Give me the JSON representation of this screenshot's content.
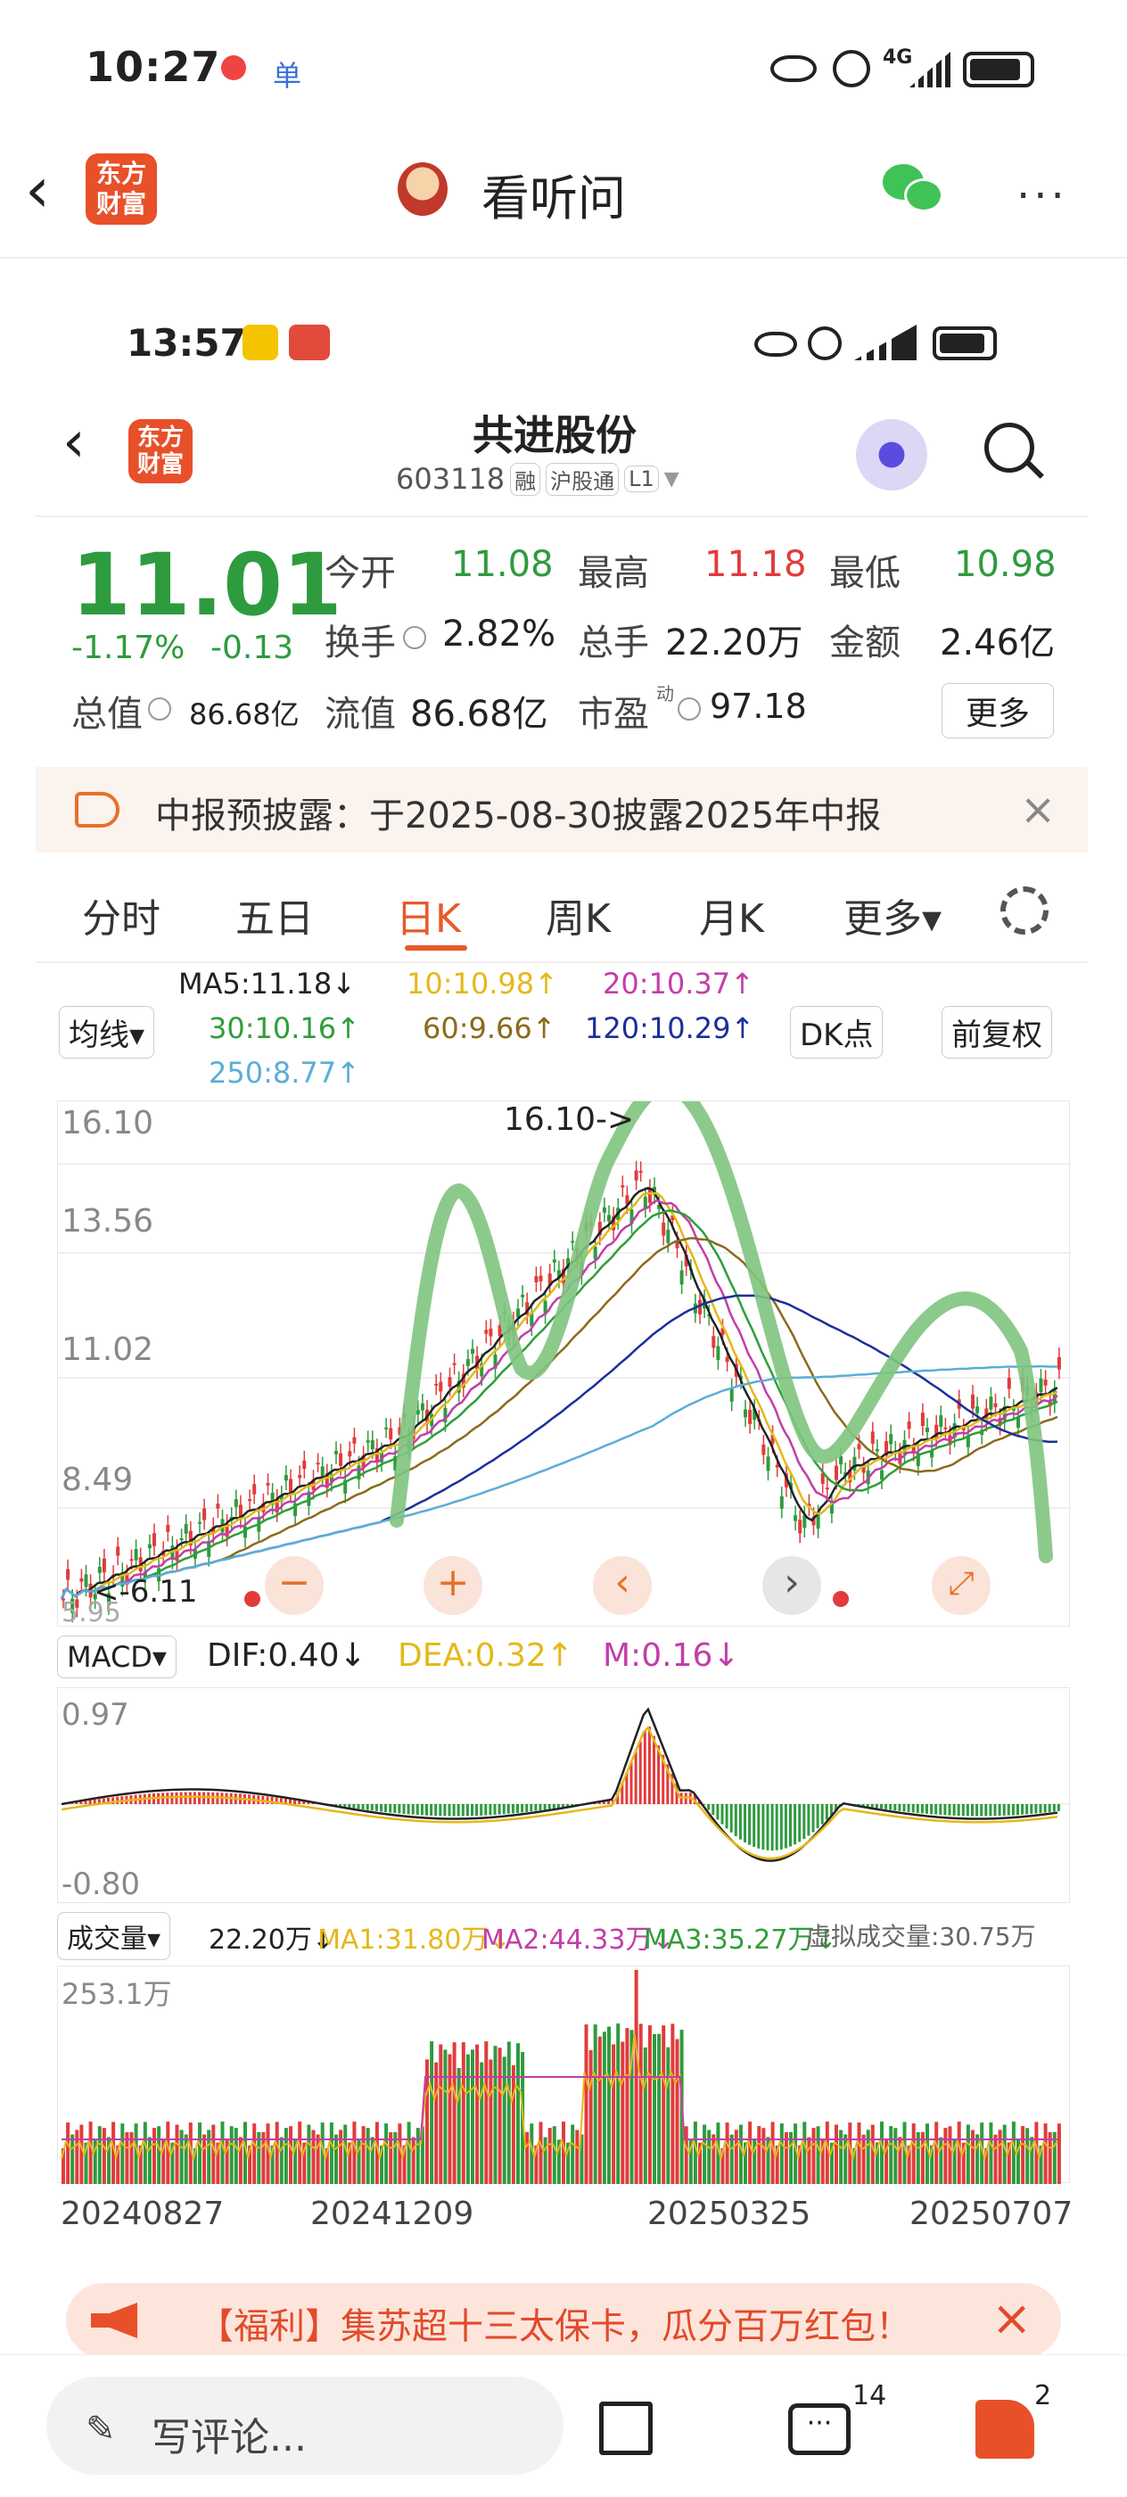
{
  "status_bar": {
    "time": "10:27",
    "indicators": [
      "eye-icon",
      "alarm-icon",
      "4G",
      "signal-icon",
      "battery-icon"
    ]
  },
  "nav": {
    "logo_text": "东方\n财富",
    "title": "看听问"
  },
  "inner_status": {
    "time": "13:57"
  },
  "stock": {
    "name": "共进股份",
    "code": "603118",
    "tags": [
      "融",
      "沪股通",
      "L1"
    ],
    "price": "11.01",
    "change_pct": "-1.17%",
    "change": "-0.13",
    "open_label": "今开",
    "open": "11.08",
    "high_label": "最高",
    "high": "11.18",
    "low_label": "最低",
    "low": "10.98",
    "turnover_label": "换手",
    "turnover": "2.82%",
    "volume_label": "总手",
    "volume": "22.20万",
    "amount_label": "金额",
    "amount": "2.46亿",
    "mcap_label": "总值",
    "mcap": "86.68亿",
    "float_label": "流值",
    "float": "86.68亿",
    "pe_label": "市盈",
    "pe_sup": "动",
    "pe": "97.18",
    "more": "更多"
  },
  "notice": {
    "text": "中报预披露：于2025-08-30披露2025年中报"
  },
  "tabs": [
    "分时",
    "五日",
    "日K",
    "周K",
    "月K",
    "更多▾"
  ],
  "active_tab": 2,
  "ma": {
    "selector": "均线▾",
    "ma5": "MA5:11.18↓",
    "ma10": "10:10.98↑",
    "ma20": "20:10.37↑",
    "ma30": "30:10.16↑",
    "ma60": "60:9.66↑",
    "ma120": "120:10.29↑",
    "ma250": "250:8.77↑",
    "dk": "DK点",
    "adjust": "前复权"
  },
  "kline": {
    "y_labels": [
      "16.10",
      "13.56",
      "11.02",
      "8.49"
    ],
    "max_label": "16.10->",
    "min_label": "<-6.11",
    "low_tick": "5.95"
  },
  "macd": {
    "selector": "MACD▾",
    "dif": "DIF:0.40↓",
    "dea": "DEA:0.32↑",
    "m": "M:0.16↓",
    "top": "0.97",
    "bottom": "-0.80"
  },
  "vol": {
    "selector": "成交量▾",
    "now": "22.20万↓",
    "ma1": "MA1:31.80万↓",
    "ma2": "MA2:44.33万↓",
    "ma3": "MA3:35.27万↓",
    "virtual": "虚拟成交量:30.75万",
    "top": "253.1万"
  },
  "dates": [
    "20240827",
    "20241209",
    "20250325",
    "20250707"
  ],
  "promo": {
    "text": "【福利】集苏超十三太保卡，瓜分百万红包！"
  },
  "bottom": {
    "comment_placeholder": "写评论...",
    "comment_count": "14",
    "like_count": "2"
  },
  "colors": {
    "up": "#e23b3b",
    "down": "#2e9b3e",
    "accent": "#e85a2a",
    "drawing": "#7fc47f"
  }
}
